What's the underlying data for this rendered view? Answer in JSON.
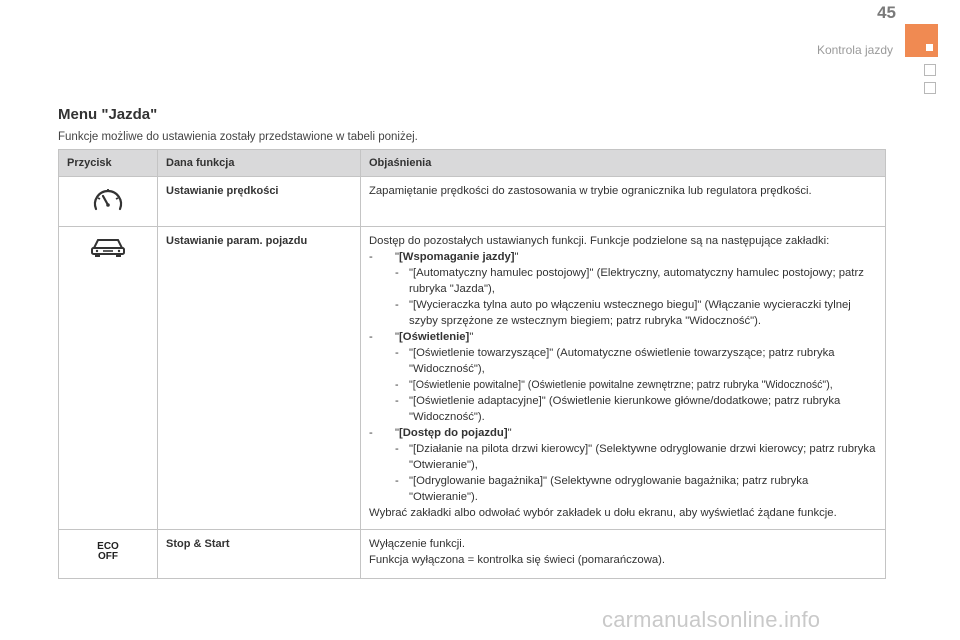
{
  "header": {
    "page_number": "45",
    "chapter": "Kontrola jazdy"
  },
  "title": "Menu \"Jazda\"",
  "intro": "Funkcje możliwe do ustawienia zostały przedstawione w tabeli poniżej.",
  "table": {
    "headers": [
      "Przycisk",
      "Dana funkcja",
      "Objaśnienia"
    ],
    "rows": [
      {
        "icon": "speedometer-icon",
        "function": "Ustawianie prędkości",
        "desc": "Zapamiętanie prędkości do zastosowania w trybie ogranicznika lub regulatora prędkości."
      },
      {
        "icon": "car-icon",
        "function": "Ustawianie param. pojazdu",
        "intro": "Dostęp do pozostałych ustawianych funkcji. Funkcje podzielone są na następujące zakładki:",
        "tabs": [
          {
            "name": "[Wspomaganie jazdy]",
            "items": [
              "\"[Automatyczny hamulec postojowy]\" (Elektryczny, automatyczny hamulec postojowy; patrz rubryka \"Jazda\"),",
              "\"[Wycieraczka tylna auto po włączeniu wstecznego biegu]\" (Włączanie wycieraczki tylnej szyby sprzężone ze wstecznym biegiem; patrz rubryka \"Widoczność\")."
            ]
          },
          {
            "name": "[Oświetlenie]",
            "items": [
              "\"[Oświetlenie towarzyszące]\" (Automatyczne oświetlenie towarzyszące; patrz rubryka \"Widoczność\"),",
              "\"[Oświetlenie powitalne]\" (Oświetlenie powitalne zewnętrzne; patrz rubryka \"Widoczność\"),",
              "\"[Oświetlenie adaptacyjne]\" (Oświetlenie kierunkowe główne/dodatkowe; patrz rubryka \"Widoczność\")."
            ]
          },
          {
            "name": "[Dostęp do pojazdu]",
            "items": [
              "\"[Działanie na pilota drzwi kierowcy]\" (Selektywne odryglowanie drzwi kierowcy; patrz rubryka \"Otwieranie\"),",
              "\"[Odryglowanie bagażnika]\" (Selektywne odryglowanie bagażnika; patrz rubryka \"Otwieranie\")."
            ]
          }
        ],
        "footer": "Wybrać zakładki albo odwołać wybór zakładek u dołu ekranu, aby wyświetlać żądane funkcje."
      },
      {
        "icon": "eco-off-icon",
        "icon_text_1": "ECO",
        "icon_text_2": "OFF",
        "function": "Stop & Start",
        "desc_1": "Wyłączenie funkcji.",
        "desc_2": "Funkcja wyłączona = kontrolka się świeci (pomarańczowa)."
      }
    ]
  },
  "watermark": "carmanualsonline.info",
  "colors": {
    "accent_tab": "#f08a52",
    "header_row": "#d9d9da"
  }
}
